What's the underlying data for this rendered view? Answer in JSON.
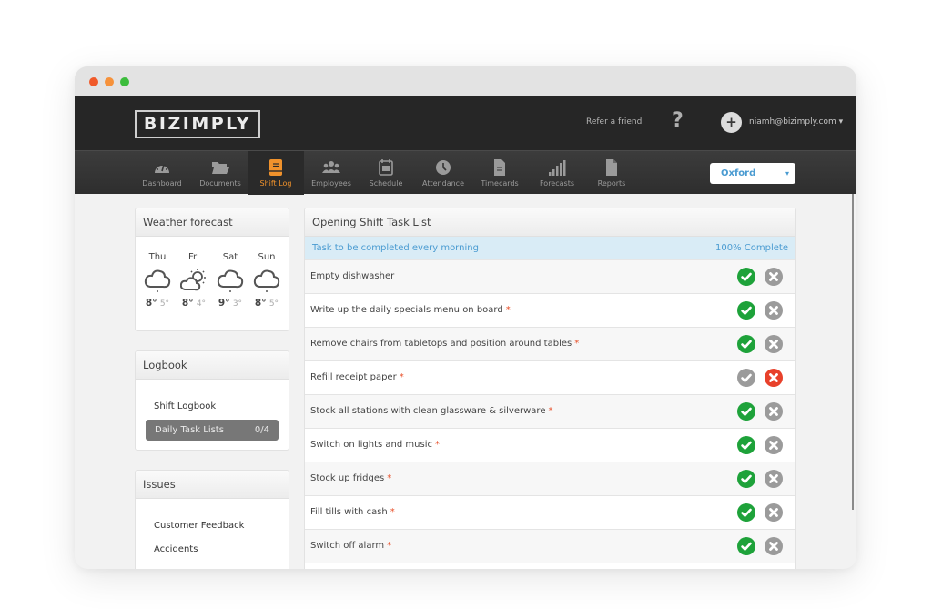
{
  "window": {
    "controls": [
      "close",
      "minimize",
      "maximize"
    ]
  },
  "header": {
    "logo": "BIZIMPLY",
    "refer_link": "Refer a friend",
    "help_icon": "?",
    "avatar_icon": "+",
    "user_email": "niamh@bizimply.com ▾"
  },
  "nav": {
    "items": [
      {
        "label": "Dashboard",
        "icon": "gauge-icon",
        "active": false
      },
      {
        "label": "Documents",
        "icon": "folder-icon",
        "active": false
      },
      {
        "label": "Shift Log",
        "icon": "logbook-icon",
        "active": true
      },
      {
        "label": "Employees",
        "icon": "people-icon",
        "active": false
      },
      {
        "label": "Schedule",
        "icon": "calendar-icon",
        "active": false
      },
      {
        "label": "Attendance",
        "icon": "clock-icon",
        "active": false
      },
      {
        "label": "Timecards",
        "icon": "timecard-icon",
        "active": false
      },
      {
        "label": "Forecasts",
        "icon": "bars-icon",
        "active": false
      },
      {
        "label": "Reports",
        "icon": "document-icon",
        "active": false
      }
    ],
    "location": {
      "selected": "Oxford",
      "caret": "▾"
    }
  },
  "colors": {
    "accent_orange": "#f0922c",
    "link_blue": "#4a9bd1",
    "check_green": "#1ea23a",
    "reject_red": "#e8412b",
    "inactive_gray": "#9b9b9b"
  },
  "weather": {
    "title": "Weather forecast",
    "days": [
      {
        "day": "Thu",
        "icon": "cloud-icon",
        "high": "8°",
        "low": "5°"
      },
      {
        "day": "Fri",
        "icon": "sun-cloud-icon",
        "high": "8°",
        "low": "4°"
      },
      {
        "day": "Sat",
        "icon": "cloud-icon",
        "high": "9°",
        "low": "3°"
      },
      {
        "day": "Sun",
        "icon": "cloud-icon",
        "high": "8°",
        "low": "5°"
      }
    ]
  },
  "logbook": {
    "title": "Logbook",
    "items": [
      {
        "label": "Shift Logbook"
      },
      {
        "label": "Daily Task Lists",
        "count": "0/4",
        "active": true
      }
    ]
  },
  "issues": {
    "title": "Issues",
    "items": [
      {
        "label": "Customer Feedback"
      },
      {
        "label": "Accidents"
      }
    ]
  },
  "tasklist": {
    "title": "Opening Shift Task List",
    "description": "Task to be completed every morning",
    "progress": "100% Complete",
    "required_marker": "*",
    "tasks": [
      {
        "label": "Empty dishwasher",
        "required": false,
        "status": "done"
      },
      {
        "label": "Write up the daily specials menu on board",
        "required": true,
        "status": "done"
      },
      {
        "label": "Remove chairs from tabletops and position around tables",
        "required": true,
        "status": "done"
      },
      {
        "label": "Refill receipt paper",
        "required": true,
        "status": "not-done"
      },
      {
        "label": "Stock all stations with clean glassware & silverware",
        "required": true,
        "status": "done"
      },
      {
        "label": "Switch on lights and music",
        "required": true,
        "status": "done"
      },
      {
        "label": "Stock up fridges",
        "required": true,
        "status": "done"
      },
      {
        "label": "Fill tills with cash",
        "required": true,
        "status": "done"
      },
      {
        "label": "Switch off alarm",
        "required": true,
        "status": "done"
      }
    ]
  }
}
